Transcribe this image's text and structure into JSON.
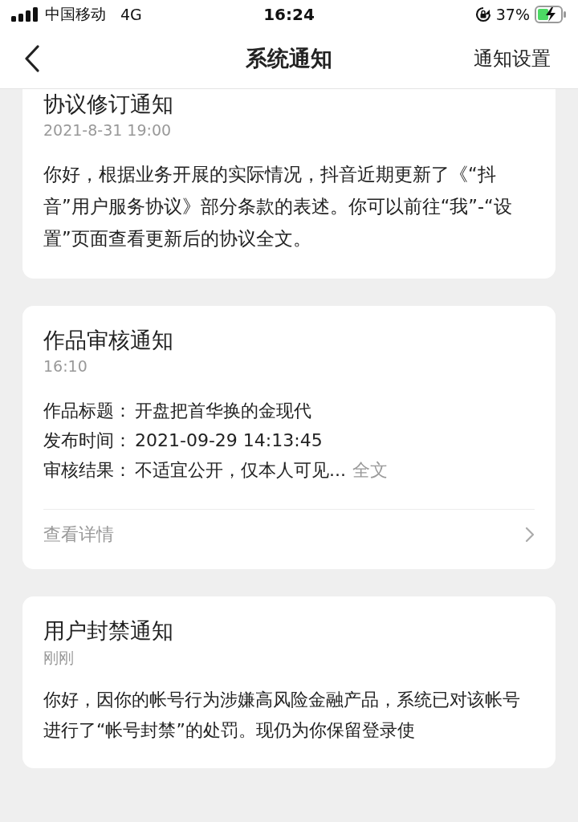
{
  "status_bar": {
    "carrier": "中国移动",
    "network": "4G",
    "time": "16:24",
    "battery": "37%"
  },
  "nav": {
    "title": "系统通知",
    "action": "通知设置"
  },
  "cards": [
    {
      "kind": "text",
      "title": "协议修订通知",
      "time": "2021-8-31 19:00",
      "body": "你好，根据业务开展的实际情况，抖音近期更新了《“抖音”用户服务协议》部分条款的表述。你可以前往“我”-“设置”页面查看更新后的协议全文。"
    },
    {
      "kind": "review",
      "title": "作品审核通知",
      "time": "16:10",
      "fields": [
        {
          "label": "作品标题：",
          "value": "开盘把首华换的金现代"
        },
        {
          "label": "发布时间：",
          "value": "2021-09-29 14:13:45"
        },
        {
          "label": "审核结果：",
          "value": "不适宜公开，仅本人可见...",
          "link": "全文"
        }
      ],
      "details": "查看详情"
    },
    {
      "kind": "text",
      "title": "用户封禁通知",
      "time": "刚刚",
      "body": "你好，因你的帐号行为涉嫌高风险金融产品，系统已对该帐号进行了“帐号封禁”的处罚。现仍为你保留登录使"
    }
  ]
}
